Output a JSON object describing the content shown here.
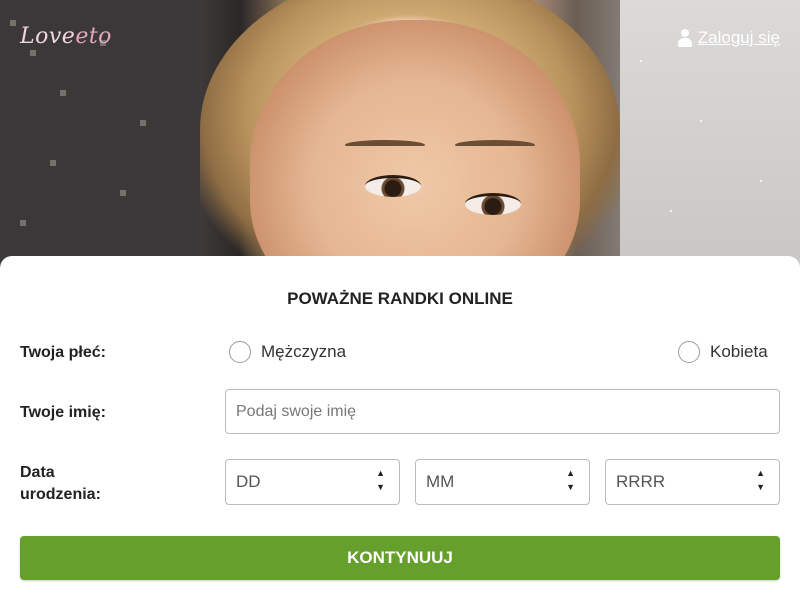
{
  "header": {
    "logo": {
      "part1": "Love",
      "part2": "eto"
    },
    "login_label": "Zaloguj się"
  },
  "form": {
    "title": "POWAŻNE RANDKI ONLINE",
    "gender": {
      "label": "Twoja płeć:",
      "options": [
        {
          "label": "Mężczyzna",
          "selected": false
        },
        {
          "label": "Kobieta",
          "selected": false
        }
      ]
    },
    "name": {
      "label": "Twoje imię:",
      "placeholder": "Podaj swoje imię",
      "value": ""
    },
    "birthdate": {
      "label_line1": "Data",
      "label_line2": "urodzenia:",
      "day": "DD",
      "month": "MM",
      "year": "RRRR"
    },
    "submit_label": "KONTYNUUJ"
  },
  "icons": {
    "login": "user-icon",
    "stepper_up": "arrow-up-icon",
    "stepper_down": "arrow-down-icon"
  },
  "colors": {
    "primary_button": "#66a02c",
    "logo": "#f3d5df"
  }
}
